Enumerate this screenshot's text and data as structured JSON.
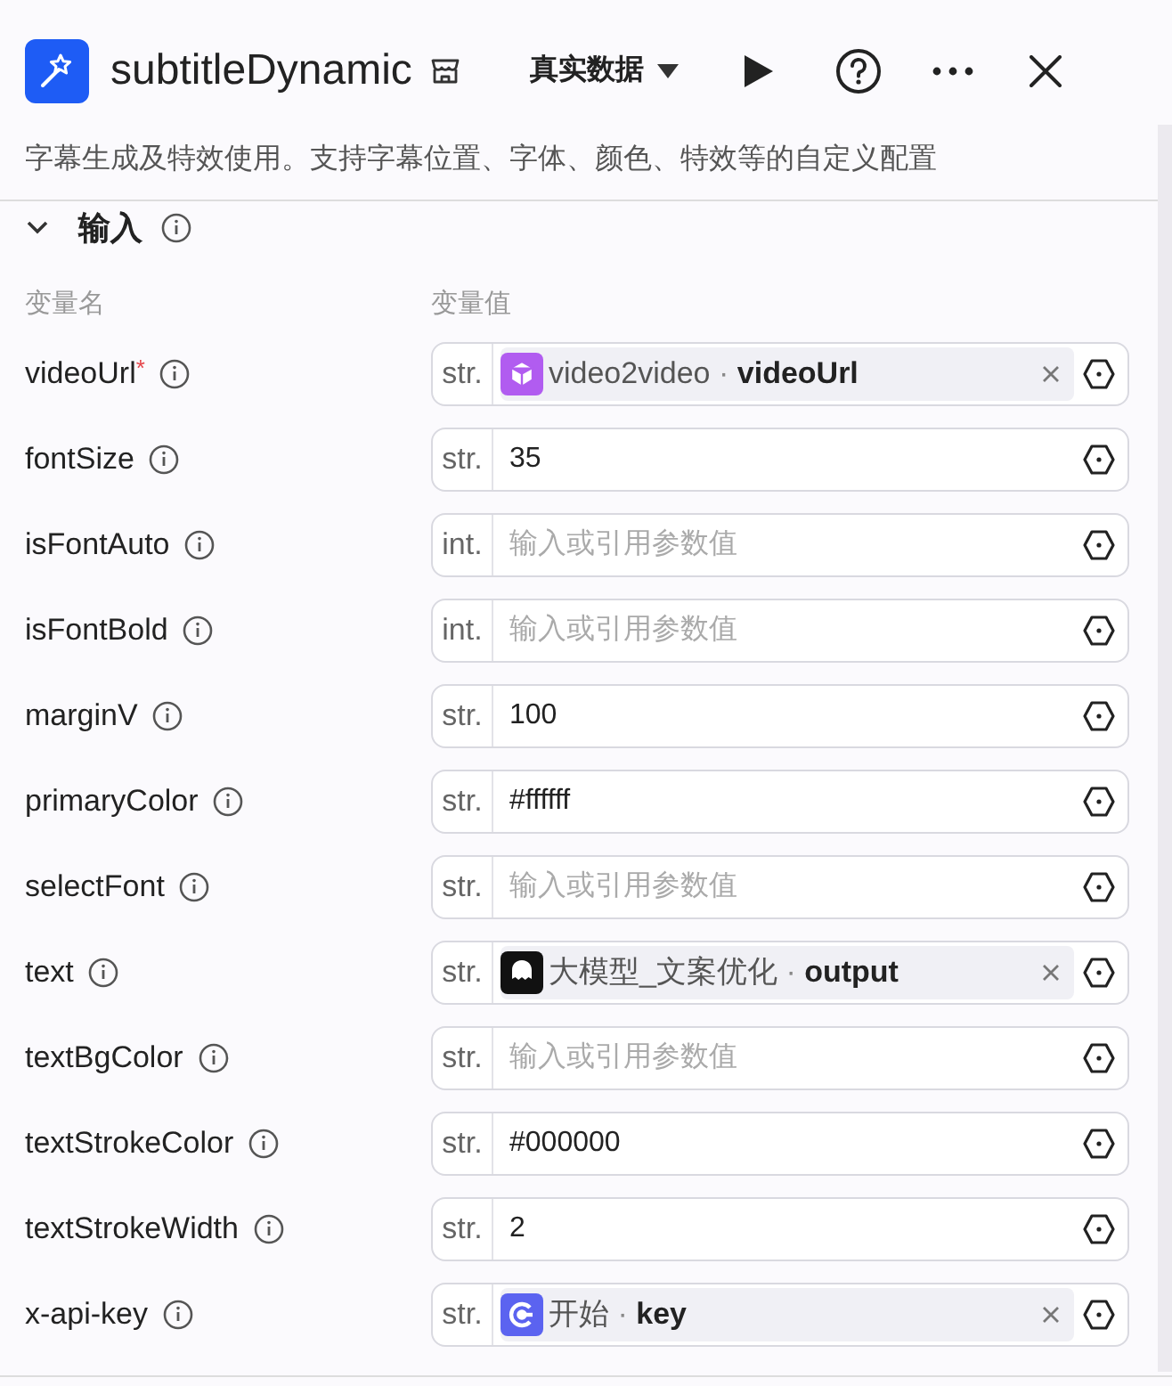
{
  "header": {
    "title": "subtitleDynamic",
    "data_mode": "真实数据"
  },
  "description": "字幕生成及特效使用。支持字幕位置、字体、颜色、特效等的自定义配置",
  "section": {
    "title": "输入",
    "expanded": true
  },
  "columns": [
    "变量名",
    "变量值"
  ],
  "required_marker": "*",
  "ref_separator": "·",
  "params": [
    {
      "name": "videoUrl",
      "required": true,
      "type": "str.",
      "ref": {
        "kind": "video",
        "color": "#b15cf0",
        "node": "video2video",
        "field": "videoUrl"
      }
    },
    {
      "name": "fontSize",
      "required": false,
      "type": "str.",
      "value": "35"
    },
    {
      "name": "isFontAuto",
      "required": false,
      "type": "int.",
      "placeholder": "输入或引用参数值"
    },
    {
      "name": "isFontBold",
      "required": false,
      "type": "int.",
      "placeholder": "输入或引用参数值"
    },
    {
      "name": "marginV",
      "required": false,
      "type": "str.",
      "value": "100"
    },
    {
      "name": "primaryColor",
      "required": false,
      "type": "str.",
      "value": "#ffffff"
    },
    {
      "name": "selectFont",
      "required": false,
      "type": "str.",
      "placeholder": "输入或引用参数值"
    },
    {
      "name": "text",
      "required": false,
      "type": "str.",
      "ref": {
        "kind": "llm",
        "color": "#111111",
        "node": "大模型_文案优化",
        "field": "output"
      }
    },
    {
      "name": "textBgColor",
      "required": false,
      "type": "str.",
      "placeholder": "输入或引用参数值"
    },
    {
      "name": "textStrokeColor",
      "required": false,
      "type": "str.",
      "value": "#000000"
    },
    {
      "name": "textStrokeWidth",
      "required": false,
      "type": "str.",
      "value": "2"
    },
    {
      "name": "x-api-key",
      "required": false,
      "type": "str.",
      "ref": {
        "kind": "start",
        "color": "#5b63f0",
        "node": "开始",
        "field": "key"
      }
    }
  ]
}
